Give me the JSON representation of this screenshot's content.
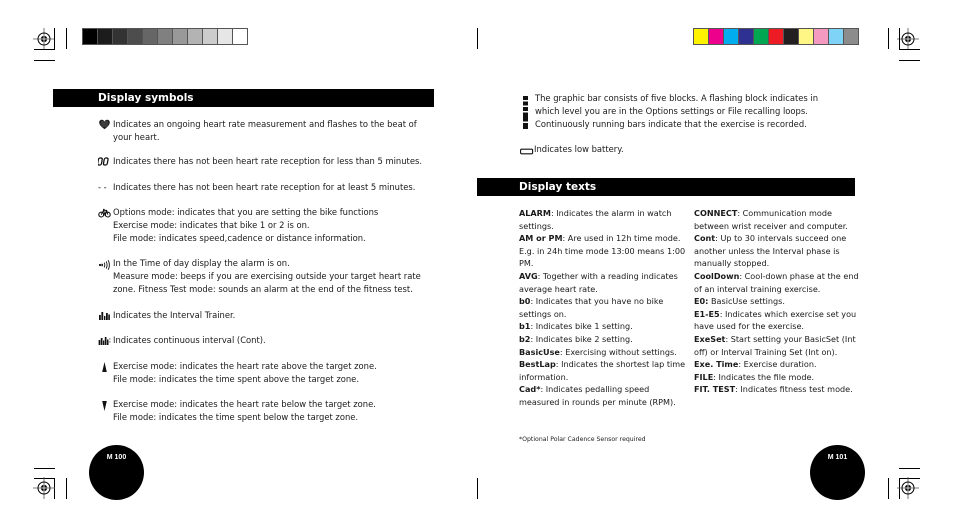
{
  "print_marks": {
    "grayscale_swatches": [
      "#000000",
      "#1c1c1c",
      "#333333",
      "#4d4d4d",
      "#666666",
      "#808080",
      "#999999",
      "#b3b3b3",
      "#cccccc",
      "#e6e6e6",
      "#ffffff"
    ],
    "color_swatches": [
      "#fff200",
      "#ec008c",
      "#00aeef",
      "#2e3192",
      "#00a651",
      "#ed1c24",
      "#231f20",
      "#fff685",
      "#f49ac1",
      "#7fd3f7",
      "#8c8c8c"
    ]
  },
  "left_page": {
    "section_title": "Display symbols",
    "symbols": [
      {
        "icon": "heart-icon",
        "text": "Indicates an ongoing heart rate measurement and flashes to the beat of\nyour heart."
      },
      {
        "icon": "no-reception-short-icon",
        "text": "Indicates there has not been heart rate reception for less than 5 minutes."
      },
      {
        "icon": "no-reception-long-icon",
        "glyph": "- -",
        "text": "Indicates there has not been heart rate reception for at least 5 minutes."
      },
      {
        "icon": "bike-icon",
        "text": "Options mode: indicates that you are setting the bike functions\nExercise mode: indicates that bike 1 or 2 is on.\nFile mode: indicates speed,cadence or distance information."
      },
      {
        "icon": "alarm-icon",
        "text": "In the Time of day display the alarm is on.\nMeasure mode: beeps if you are exercising outside your target heart rate\nzone. Fitness Test mode: sounds an alarm at the end of the fitness test."
      },
      {
        "icon": "interval-trainer-icon",
        "text": "Indicates the Interval Trainer."
      },
      {
        "icon": "continuous-interval-icon",
        "text": "Indicates continuous interval (Cont)."
      },
      {
        "icon": "arrow-up-icon",
        "text": "Exercise mode: indicates the heart rate above the target zone.\nFile mode: indicates the time spent above the target zone."
      },
      {
        "icon": "arrow-down-icon",
        "text": "Exercise mode: indicates the heart rate below the target zone.\nFile mode: indicates the time spent below the target zone."
      }
    ],
    "page_number": "M 100"
  },
  "right_page": {
    "graphic_bar_text": "The graphic bar consists of five blocks. A flashing block indicates in\nwhich level you are in the Options settings or File recalling loops.\nContinuously running bars indicate that the exercise is recorded.",
    "battery_text": "Indicates low battery.",
    "section_title": "Display texts",
    "terms_col1": [
      {
        "term": "ALARM",
        "desc": ": Indicates the alarm in watch settings."
      },
      {
        "term": "AM or PM",
        "desc": ": Are used in 12h time mode. E.g. in 24h time mode 13:00 means 1:00 PM."
      },
      {
        "term": "AVG",
        "desc": ": Together with a reading indicates average heart rate."
      },
      {
        "term": "b0",
        "desc": ": Indicates that you have no bike settings on."
      },
      {
        "term": "b1",
        "desc": ": Indicates bike 1 setting."
      },
      {
        "term": "b2",
        "desc": ": Indicates bike 2 setting."
      },
      {
        "term": "BasicUse",
        "desc": ": Exercising without settings."
      },
      {
        "term": "BestLap",
        "desc": ": Indicates the shortest lap time information."
      },
      {
        "term": "Cad*",
        "desc": ": Indicates pedalling speed measured in rounds per minute (RPM)."
      }
    ],
    "terms_col2": [
      {
        "term": "CONNECT",
        "desc": ": Communication mode between wrist receiver and computer."
      },
      {
        "term": "Cont",
        "desc": ": Up to 30 intervals succeed one another unless the Interval phase is manually stopped."
      },
      {
        "term": "CoolDown",
        "desc": ": Cool-down phase at the end of an interval training exercise."
      },
      {
        "term": "E0:",
        "desc": " BasicUse settings."
      },
      {
        "term": "E1-E5",
        "desc": ": Indicates which exercise set you have used for the exercise."
      },
      {
        "term": "ExeSet",
        "desc": ": Start setting your BasicSet (Int off) or Interval Training Set (Int on)."
      },
      {
        "term": "Exe. Time",
        "desc": ": Exercise duration."
      },
      {
        "term": "FILE",
        "desc": ": Indicates the file mode."
      },
      {
        "term": "FIT. TEST",
        "desc": ": Indicates fitness test mode."
      }
    ],
    "footnote": "*Optional Polar Cadence Sensor required",
    "page_number": "M 101"
  }
}
